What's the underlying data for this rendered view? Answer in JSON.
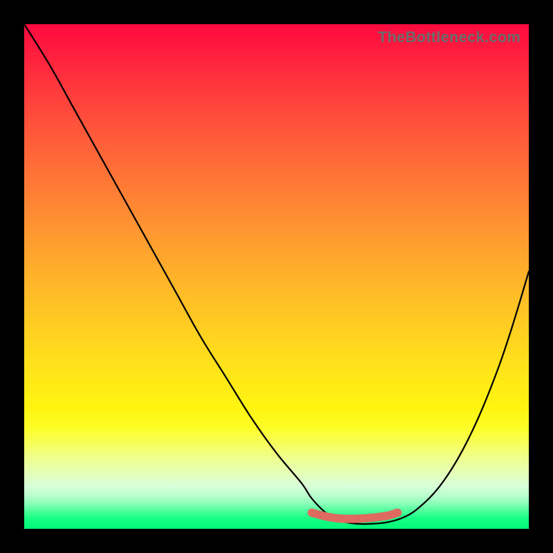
{
  "watermark": "TheBottleneck.com",
  "chart_data": {
    "type": "line",
    "title": "",
    "xlabel": "",
    "ylabel": "",
    "xlim": [
      0,
      100
    ],
    "ylim": [
      0,
      100
    ],
    "grid": false,
    "legend": false,
    "background_gradient": {
      "top": "#ff0a3f",
      "middle": "#ffd31f",
      "bottom": "#00f877"
    },
    "series": [
      {
        "name": "black-curve",
        "color": "#000000",
        "x": [
          0,
          5,
          10,
          15,
          20,
          25,
          30,
          35,
          40,
          45,
          50,
          55,
          57,
          60,
          63,
          66,
          69,
          72,
          75,
          78,
          82,
          86,
          90,
          94,
          97,
          100
        ],
        "values": [
          100,
          92,
          83,
          74,
          65,
          56,
          47,
          38,
          30,
          22,
          15,
          9,
          6,
          3,
          1.5,
          1,
          1,
          1.3,
          2.2,
          4,
          8,
          14,
          22,
          32,
          41,
          51
        ]
      },
      {
        "name": "red-band",
        "color": "#df6a60",
        "x": [
          57,
          60,
          63,
          66,
          69,
          72,
          74
        ],
        "values": [
          3.2,
          2.4,
          2.0,
          2.0,
          2.2,
          2.6,
          3.2
        ]
      }
    ]
  }
}
